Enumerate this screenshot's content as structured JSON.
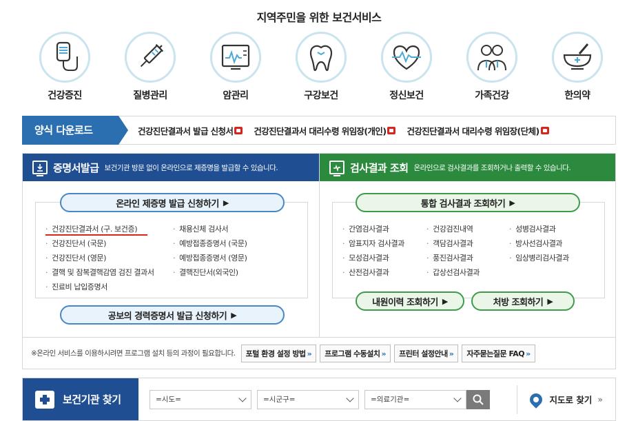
{
  "section_title": "지역주민을 위한 보건서비스",
  "services": [
    {
      "label": "건강증진",
      "icon": "iv-bag-icon"
    },
    {
      "label": "질병관리",
      "icon": "syringe-icon"
    },
    {
      "label": "암관리",
      "icon": "monitor-chart-icon"
    },
    {
      "label": "구강보건",
      "icon": "tooth-icon"
    },
    {
      "label": "정신보건",
      "icon": "heart-pulse-icon"
    },
    {
      "label": "가족건강",
      "icon": "doctors-icon"
    },
    {
      "label": "한의약",
      "icon": "mortar-pestle-icon"
    }
  ],
  "forms": {
    "heading": "양식 다운로드",
    "links": [
      "건강진단결과서 발급 신청서",
      "건강진단결과서 대리수령 위임장(개인)",
      "건강진단결과서 대리수령 위임장(단체)"
    ]
  },
  "cert_panel": {
    "title": "증명서발급",
    "description": "보건기관 방문 없이 온라인으로 제증명을 발급할 수 있습니다.",
    "primary_button": "온라인 제증명 발급 신청하기",
    "items": [
      "건강진단결과서 (구. 보건증)",
      "채용신체 검사서",
      "건강진단서 (국문)",
      "예방접종증명서 (국문)",
      "건강진단서 (영문)",
      "예방접종증명서 (영문)",
      "결핵 및 잠복결핵감염 검진 결과서",
      "결핵진단서(외국인)",
      "진료비 납입증명서"
    ],
    "secondary_button": "공보의 경력증명서 발급 신청하기"
  },
  "result_panel": {
    "title": "검사결과 조회",
    "description": "온라인으로 검사결과를 조회하거나 출력할 수 있습니다.",
    "primary_button": "통합 검사결과 조회하기",
    "items": [
      "간염검사결과",
      "건강검진내역",
      "성병검사결과",
      "암표지자 검사결과",
      "객담검사결과",
      "방사선검사결과",
      "모성검사결과",
      "풍진검사결과",
      "임상병리검사결과",
      "산전검사결과",
      "갑상선검사결과"
    ],
    "button_left": "내원이력 조회하기",
    "button_right": "처방 조회하기"
  },
  "notice": {
    "text": "※온라인 서비스를 이용하시려면 프로그램 설치 등의 과정이 필요합니다.",
    "buttons": [
      "포털 환경 설정 방법",
      "프로그램 수동설치",
      "프린터 설정안내",
      "자주묻는질문 FAQ"
    ]
  },
  "finder": {
    "heading": "보건기관 찾기",
    "selects": [
      "=시도=",
      "=시군구=",
      "=의료기관="
    ],
    "map_link": "지도로 찾기"
  },
  "colors": {
    "primary_blue": "#1f4e93",
    "form_blue": "#2b6fb0",
    "green": "#2b8a3e",
    "underline_red": "#d7261e"
  }
}
